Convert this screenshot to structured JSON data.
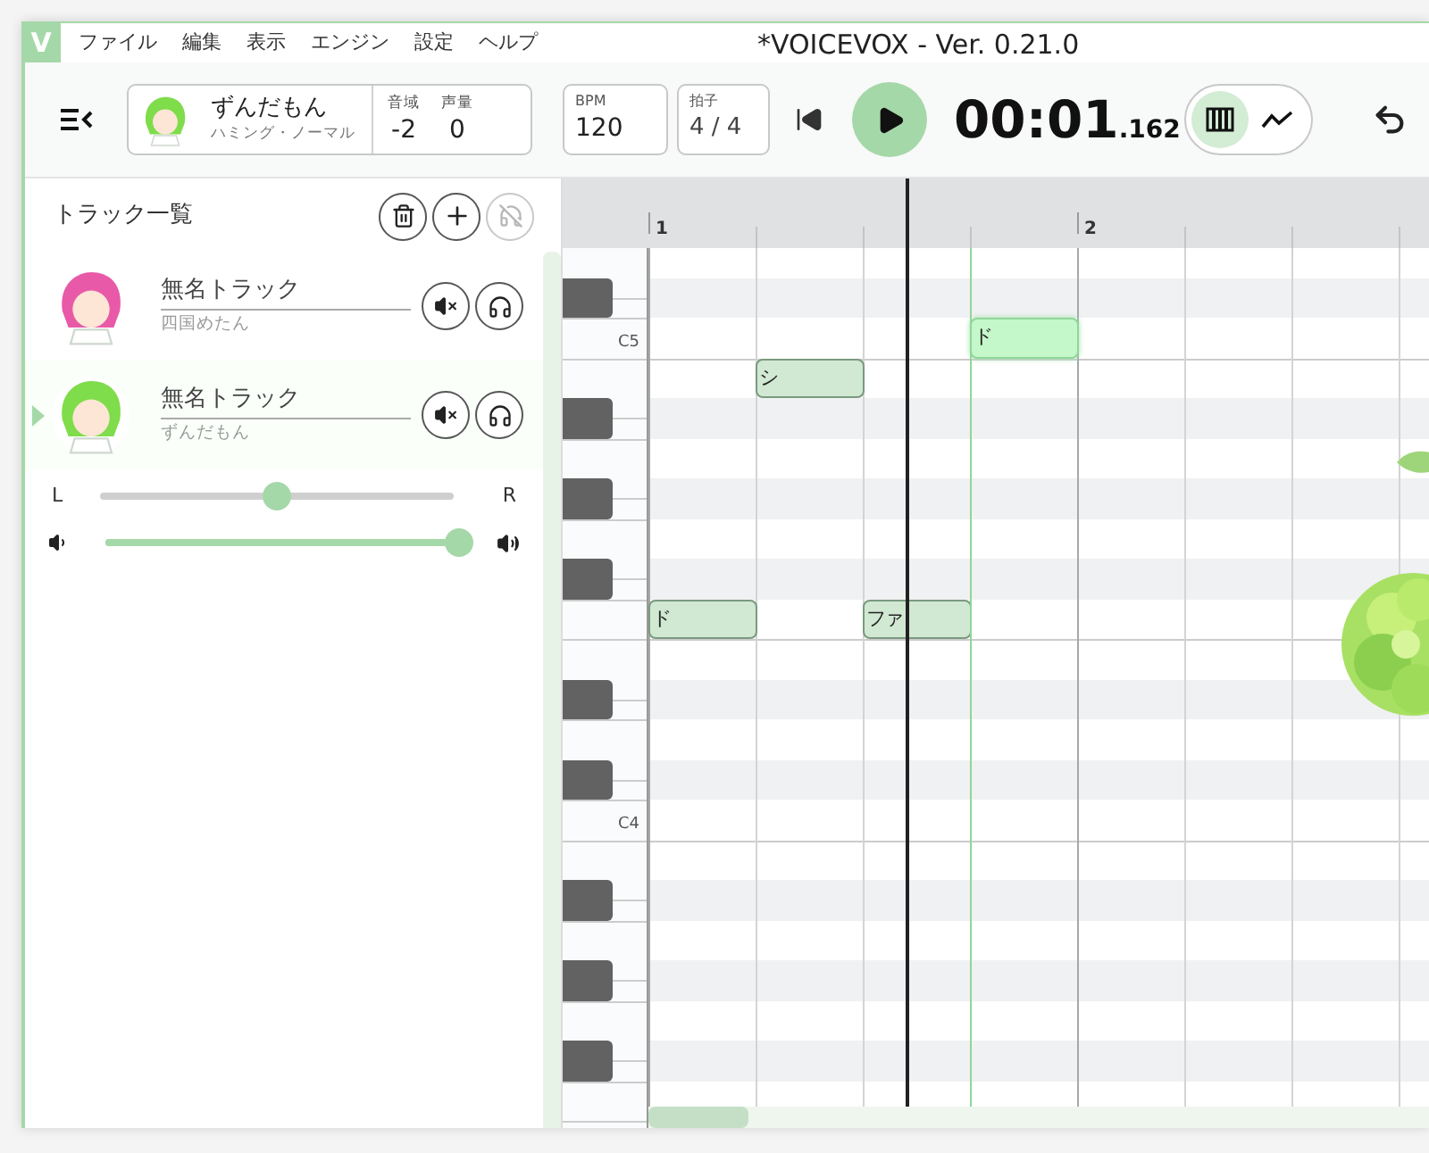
{
  "window": {
    "logo": "V",
    "title": "*VOICEVOX - Ver. 0.21.0"
  },
  "menu": [
    "ファイル",
    "編集",
    "表示",
    "エンジン",
    "設定",
    "ヘルプ"
  ],
  "singer": {
    "name": "ずんだもん",
    "style": "ハミング・ノーマル",
    "color": "#7fdc4a",
    "range_label": "音域",
    "range": "-2",
    "volume_label": "声量",
    "volume": "0"
  },
  "bpm": {
    "label": "BPM",
    "value": "120"
  },
  "time_signature": {
    "label": "拍子",
    "value": "4 / 4"
  },
  "time": {
    "main": "00:01",
    "fraction": ".162"
  },
  "view_modes": [
    {
      "kind": "piano",
      "selected": true
    },
    {
      "kind": "pitch",
      "selected": false
    }
  ],
  "track_panel": {
    "title": "トラック一覧",
    "solo_clear_disabled": true
  },
  "tracks": [
    {
      "name": "無名トラック",
      "singer": "四国めたん",
      "color": "#e85aa8",
      "selected": false
    },
    {
      "name": "無名トラック",
      "singer": "ずんだもん",
      "color": "#7fdc4a",
      "selected": true
    }
  ],
  "pan": {
    "left": "L",
    "right": "R",
    "level": 0.5
  },
  "master_volume": {
    "level": 1
  },
  "ruler": [
    "1",
    "2"
  ],
  "key_labels": [
    "C5",
    "C4"
  ],
  "notes": [
    {
      "lyric": "ド",
      "selected": true
    },
    {
      "lyric": "シ",
      "selected": false
    },
    {
      "lyric": "ド",
      "selected": false
    },
    {
      "lyric": "ファ",
      "selected": false
    }
  ]
}
